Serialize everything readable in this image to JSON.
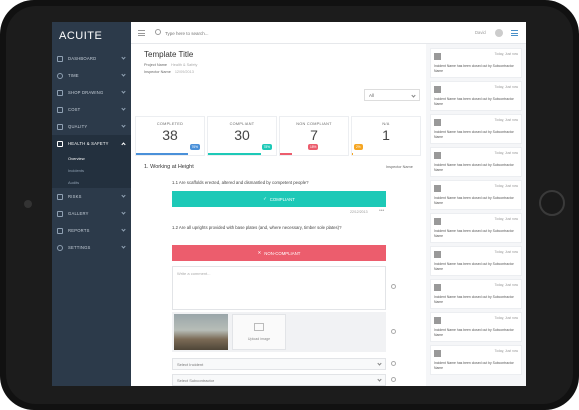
{
  "app": {
    "logo": "ACUITE"
  },
  "sidebar": {
    "items": [
      {
        "label": "DASHBOARD"
      },
      {
        "label": "TIME"
      },
      {
        "label": "SHOP DRAWING"
      },
      {
        "label": "COST"
      },
      {
        "label": "QUALITY"
      },
      {
        "label": "HEALTH & SAFETY"
      },
      {
        "label": "RISKS"
      },
      {
        "label": "GALLERY"
      },
      {
        "label": "REPORTS"
      },
      {
        "label": "SETTINGS"
      }
    ],
    "sub_items": [
      {
        "label": "Overview"
      },
      {
        "label": "Incidents"
      },
      {
        "label": "Audits"
      }
    ]
  },
  "topbar": {
    "search_placeholder": "Type here to search...",
    "user": "David"
  },
  "template": {
    "title": "Template Title",
    "project_label": "Project Name",
    "project_value": "Health & Safety",
    "inspector_label": "Inspector Name",
    "inspector_value": "12/09/2013",
    "filter_value": "All"
  },
  "stats": [
    {
      "label": "COMPLETED",
      "value": "38",
      "pct": "76%",
      "color": "#4a90d9"
    },
    {
      "label": "COMPLIANT",
      "value": "30",
      "pct": "78%",
      "color": "#1dc9b7"
    },
    {
      "label": "NON COMPLIANT",
      "value": "7",
      "pct": "18%",
      "color": "#ec5d6d"
    },
    {
      "label": "N/A",
      "value": "1",
      "pct": "2%",
      "color": "#f5a623"
    }
  ],
  "section": {
    "title": "1. Working at Height",
    "inspector": "Inspector Name"
  },
  "questions": [
    {
      "text": "1.1 Are scaffolds erected, altered and dismantled by competent people?",
      "answer": "COMPLIANT",
      "date": "22/12/2013"
    },
    {
      "text": "1.2 Are all uprights provided with base plates (and, where necessary, timber sole plates)?",
      "answer": "NON-COMPLIANT"
    }
  ],
  "comment_placeholder": "Write a comment...",
  "upload_label": "Upload image",
  "select_incident": "Select Incident",
  "select_subcontractor": "Select Subcontractor",
  "notifications": [
    {
      "time": "Today, Just now",
      "text": "Incident Name has been closed out by Subcontractor Name"
    },
    {
      "time": "Today, Just now",
      "text": "Incident Name has been closed out by Subcontractor Name"
    },
    {
      "time": "Today, Just now",
      "text": "Incident Name has been closed out by Subcontractor Name"
    },
    {
      "time": "Today, Just now",
      "text": "Incident Name has been closed out by Subcontractor Name"
    },
    {
      "time": "Today, Just now",
      "text": "Incident Name has been closed out by Subcontractor Name"
    },
    {
      "time": "Today, Just now",
      "text": "Incident Name has been closed out by Subcontractor Name"
    },
    {
      "time": "Today, Just now",
      "text": "Incident Name has been closed out by Subcontractor Name"
    },
    {
      "time": "Today, Just now",
      "text": "Incident Name has been closed out by Subcontractor Name"
    },
    {
      "time": "Today, Just now",
      "text": "Incident Name has been closed out by Subcontractor Name"
    },
    {
      "time": "Today, Just now",
      "text": "Incident Name has been closed out by Subcontractor Name"
    }
  ]
}
